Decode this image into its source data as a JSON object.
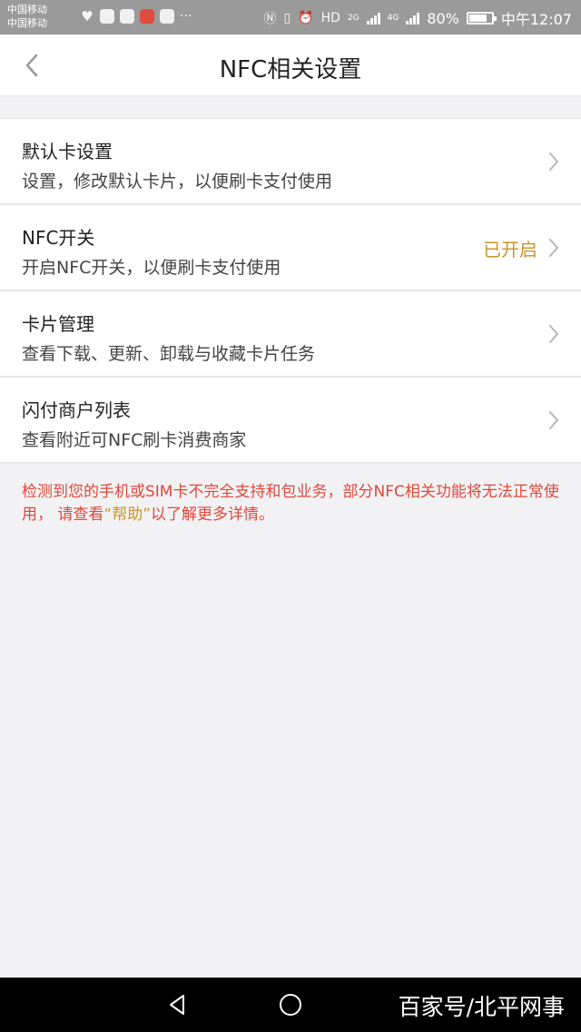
{
  "status_bar": {
    "carrier_1": "中国移动",
    "carrier_2": "中国移动",
    "network_1": "2G",
    "network_2": "4G",
    "battery": "80%",
    "battery_level": 0.8,
    "time": "中午12:07",
    "dots": "···"
  },
  "header": {
    "title": "NFC相关设置"
  },
  "rows": [
    {
      "title": "默认卡设置",
      "subtitle": "设置，修改默认卡片，以便刷卡支付使用",
      "status": ""
    },
    {
      "title": "NFC开关",
      "subtitle": "开启NFC开关，以便刷卡支付使用",
      "status": "已开启"
    },
    {
      "title": "卡片管理",
      "subtitle": "查看下载、更新、卸载与收藏卡片任务",
      "status": ""
    },
    {
      "title": "闪付商户列表",
      "subtitle": "查看附近可NFC刷卡消费商家",
      "status": ""
    }
  ],
  "notice": {
    "before": "检测到您的手机或SIM卡不完全支持和包业务，部分NFC相关功能将无法正常使用， 请查看",
    "link": "“帮助”",
    "after": "以了解更多详情。"
  },
  "navbar": {
    "watermark": "百家号/北平网事"
  },
  "colors": {
    "accent": "#c8962b",
    "warning": "#e0483a",
    "background": "#f2f2f4"
  }
}
